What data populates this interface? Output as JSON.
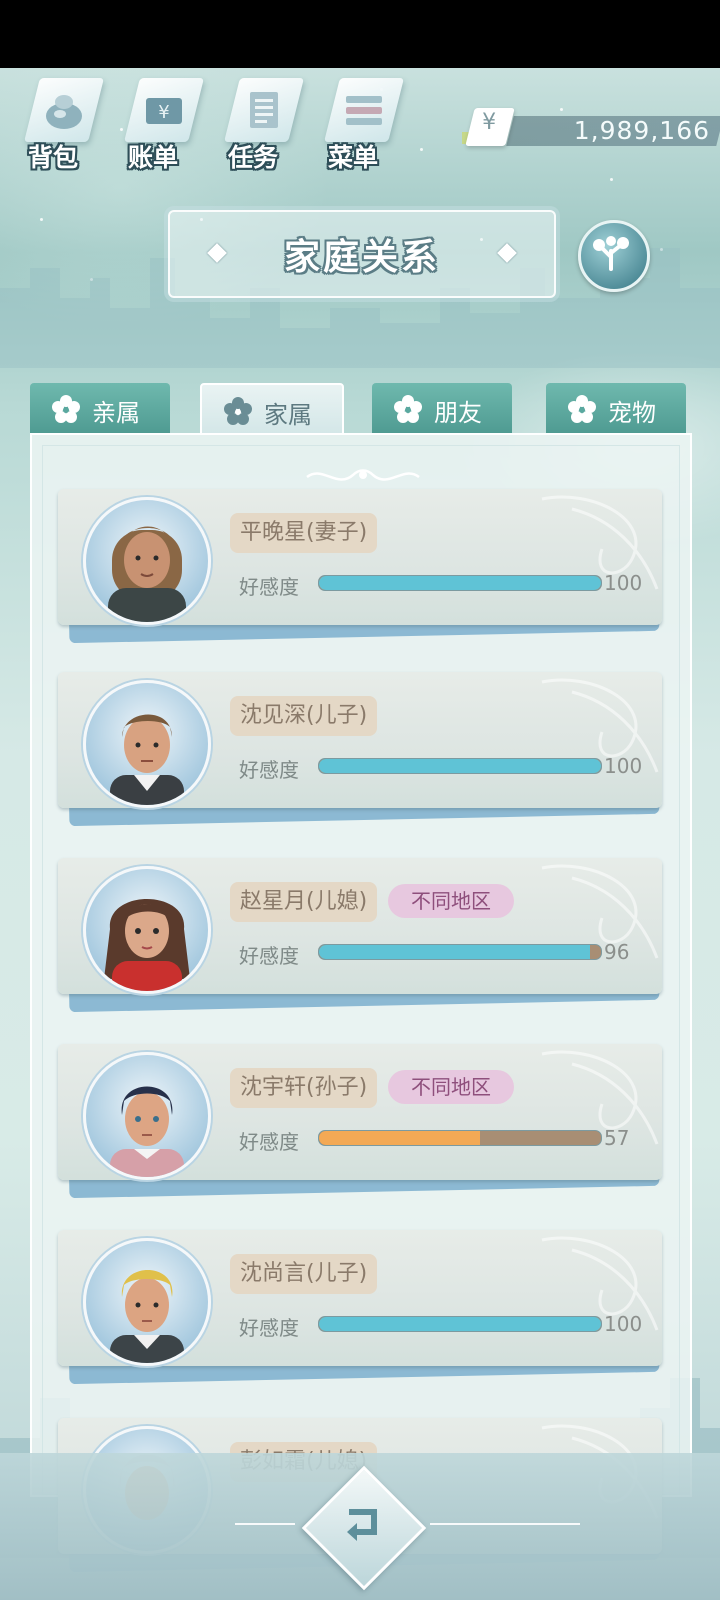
{
  "topnav": [
    {
      "label": "背包",
      "icon": "bag-icon"
    },
    {
      "label": "账单",
      "icon": "bill-icon"
    },
    {
      "label": "任务",
      "icon": "task-icon"
    },
    {
      "label": "菜单",
      "icon": "menu-icon"
    }
  ],
  "money": {
    "symbol": "¥",
    "amount": "1,989,166"
  },
  "header": {
    "title": "家庭关系"
  },
  "tabs": [
    {
      "label": "亲属",
      "active": false
    },
    {
      "label": "家属",
      "active": true
    },
    {
      "label": "朋友",
      "active": false
    },
    {
      "label": "宠物",
      "active": false
    }
  ],
  "affinity_label": "好感度",
  "members": [
    {
      "name": "平晚星(妻子)",
      "region": "",
      "affinity": 100,
      "affinity_text": "100"
    },
    {
      "name": "沈见深(儿子)",
      "region": "",
      "affinity": 100,
      "affinity_text": "100"
    },
    {
      "name": "赵星月(儿媳)",
      "region": "不同地区",
      "affinity": 96,
      "affinity_text": "96"
    },
    {
      "name": "沈宇轩(孙子)",
      "region": "不同地区",
      "affinity": 57,
      "affinity_text": "57"
    },
    {
      "name": "沈尚言(儿子)",
      "region": "",
      "affinity": 100,
      "affinity_text": "100"
    },
    {
      "name": "彭如霜(儿媳)",
      "region": "",
      "affinity": null,
      "affinity_text": ""
    }
  ],
  "colors": {
    "bar_full": "#5fc3d6",
    "bar_mid": "#f3a955",
    "bar_empty": "#a88e74",
    "tab_inactive": "#5aa89f",
    "name_tag": "#e4d8c6",
    "region_tag": "#e7c8df"
  }
}
